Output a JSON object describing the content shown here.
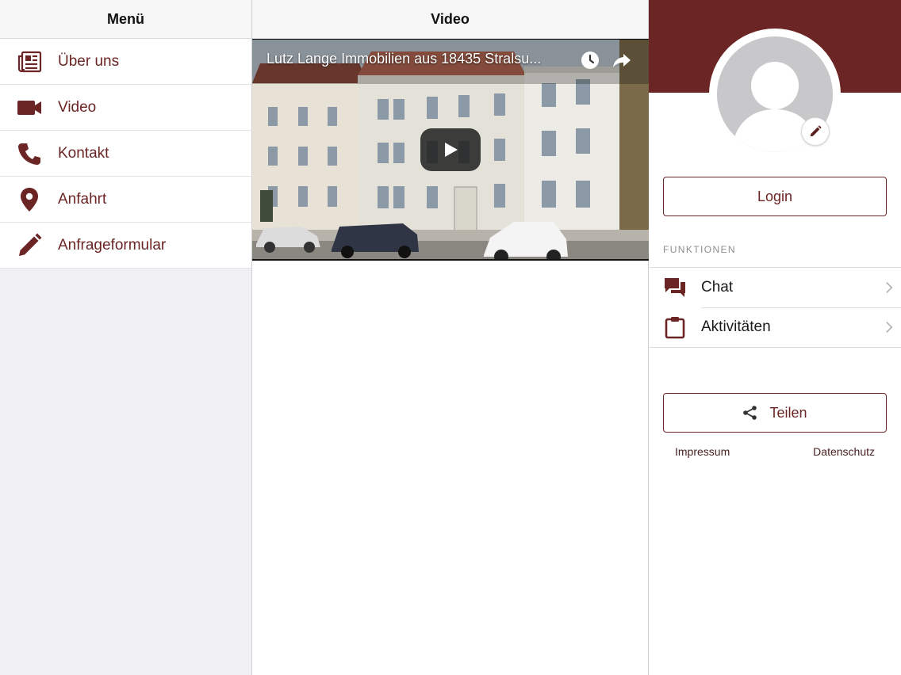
{
  "colors": {
    "accent": "#6b2525",
    "pane_bg": "#efeff4",
    "divider": "#dcdcdf",
    "muted_text": "#8e8e93"
  },
  "menu": {
    "title": "Menü",
    "items": [
      {
        "label": "Über uns",
        "icon": "newspaper-icon"
      },
      {
        "label": "Video",
        "icon": "video-camera-icon"
      },
      {
        "label": "Kontakt",
        "icon": "phone-icon"
      },
      {
        "label": "Anfahrt",
        "icon": "location-pin-icon"
      },
      {
        "label": "Anfrageformular",
        "icon": "pencil-icon"
      }
    ]
  },
  "video": {
    "title": "Video",
    "player": {
      "video_title": "Lutz Lange Immobilien aus 18435 Stralsu...",
      "icons": [
        "clock-icon",
        "share-arrow-icon",
        "play-icon"
      ]
    }
  },
  "profile": {
    "avatar_icon": "user-avatar-icon",
    "edit_icon": "edit-pencil-icon",
    "login_label": "Login",
    "functions_label": "FUNKTIONEN",
    "functions": [
      {
        "label": "Chat",
        "icon": "chat-bubbles-icon"
      },
      {
        "label": "Aktivitäten",
        "icon": "clipboard-icon"
      }
    ],
    "share_label": "Teilen",
    "share_icon": "share-nodes-icon",
    "links": {
      "impressum": "Impressum",
      "datenschutz": "Datenschutz"
    }
  }
}
